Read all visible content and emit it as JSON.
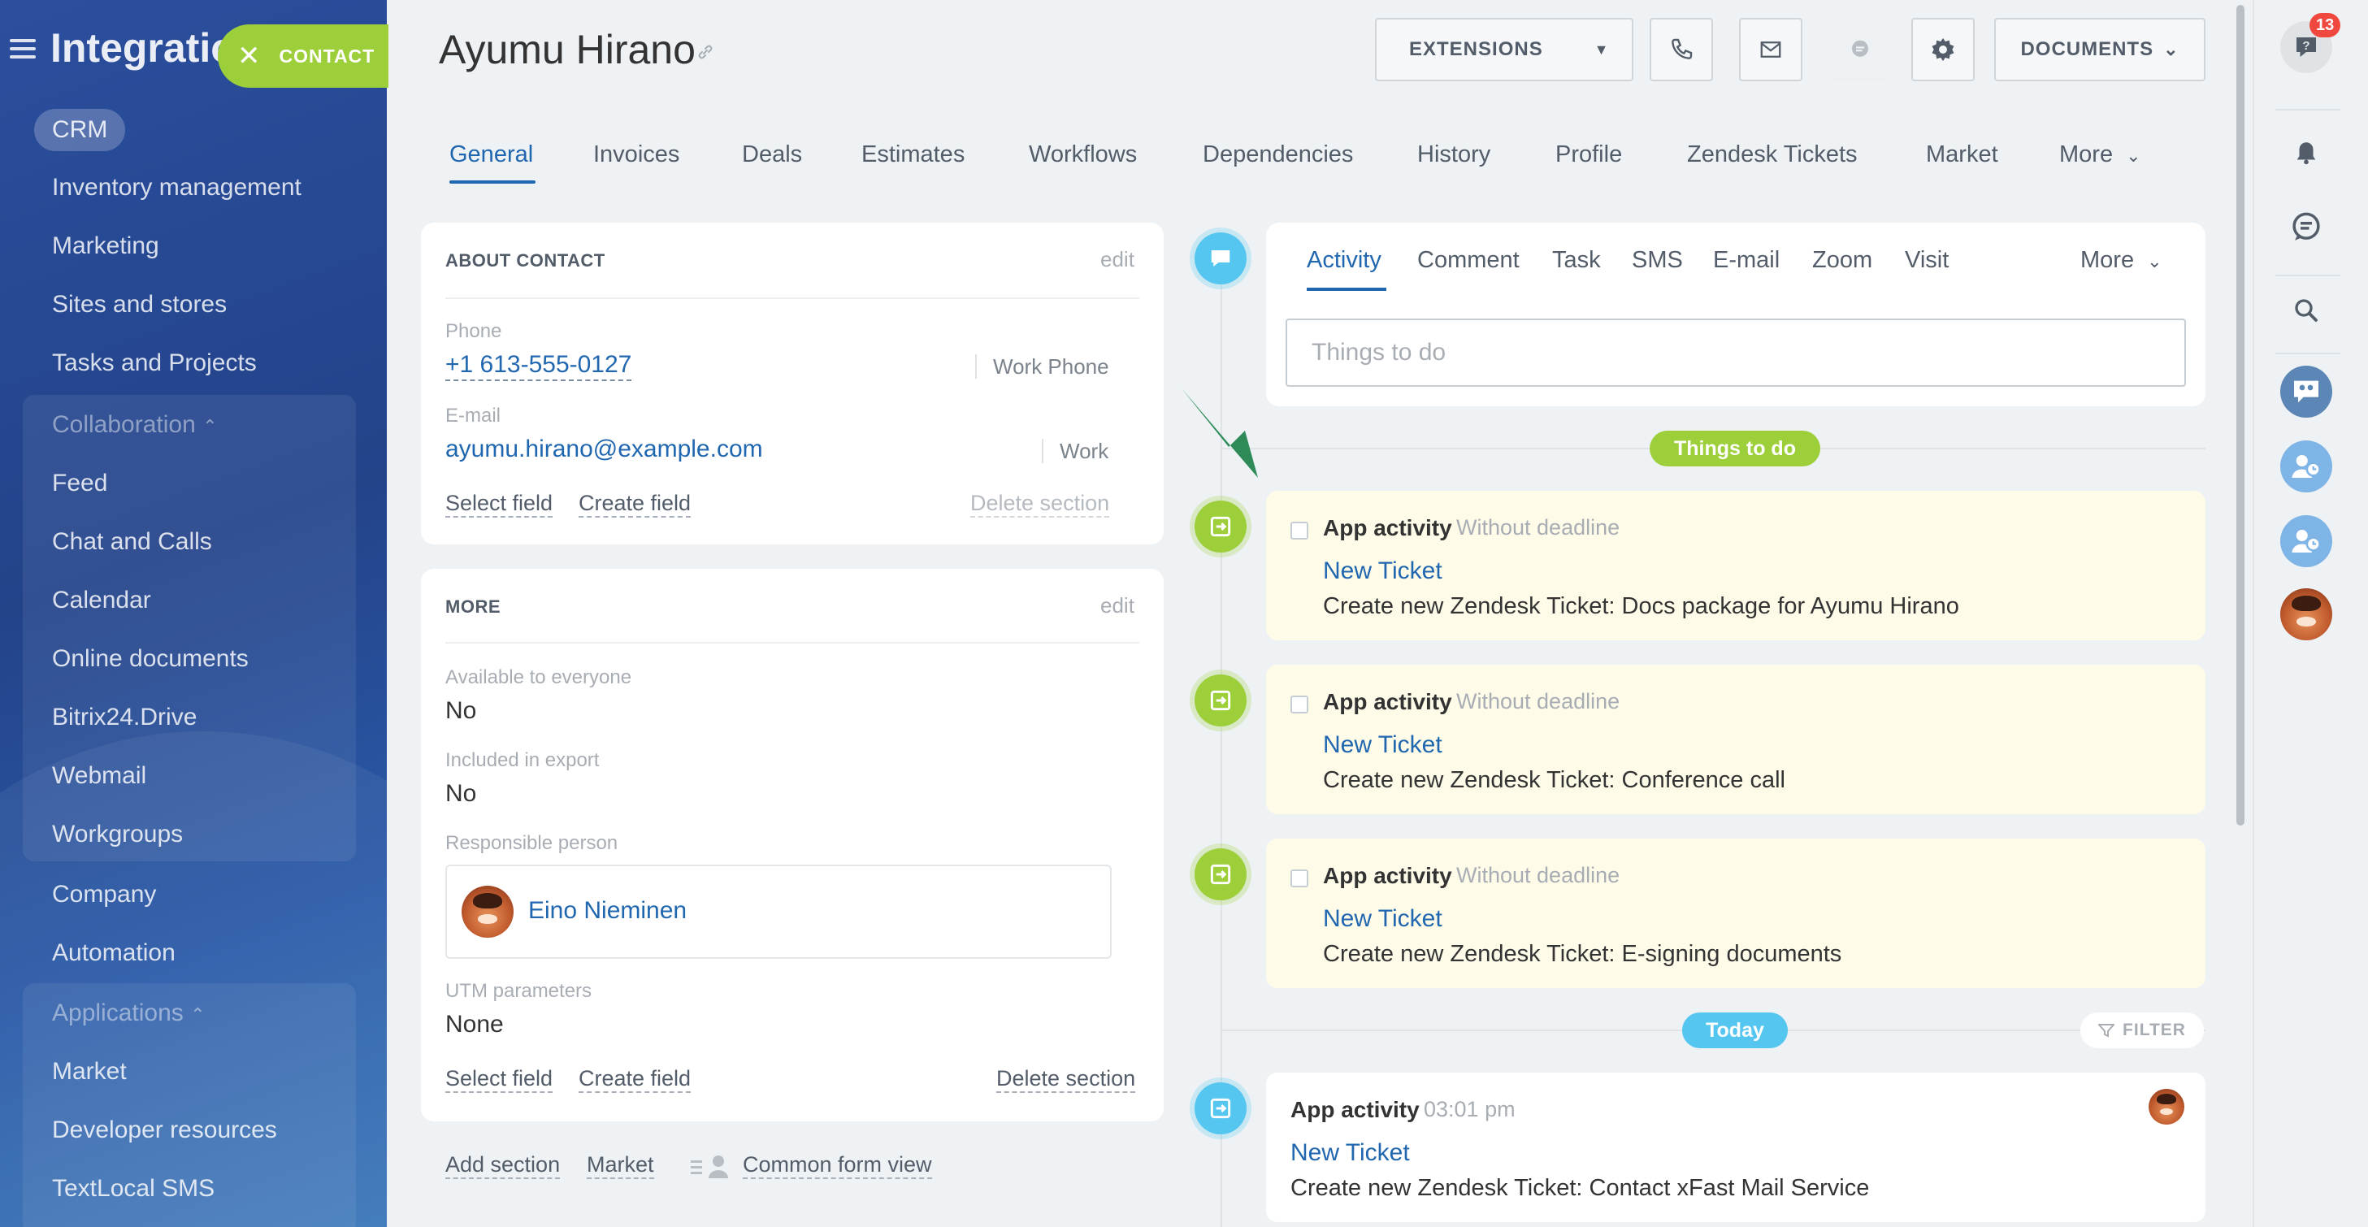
{
  "sidebar": {
    "title": "Integratio",
    "contact_button": "CONTACT",
    "crm": "CRM",
    "items_top": [
      "Inventory management",
      "Marketing",
      "Sites and stores",
      "Tasks and Projects"
    ],
    "collaboration_title": "Collaboration",
    "collaboration_items": [
      "Feed",
      "Chat and Calls",
      "Calendar",
      "Online documents",
      "Bitrix24.Drive",
      "Webmail",
      "Workgroups"
    ],
    "items_mid": [
      "Company",
      "Automation"
    ],
    "applications_title": "Applications",
    "applications_items": [
      "Market",
      "Developer resources",
      "TextLocal SMS"
    ]
  },
  "header": {
    "title": "Ayumu Hirano",
    "extensions": "EXTENSIONS",
    "documents": "DOCUMENTS"
  },
  "tabs": [
    "General",
    "Invoices",
    "Deals",
    "Estimates",
    "Workflows",
    "Dependencies",
    "History",
    "Profile",
    "Zendesk Tickets",
    "Market",
    "More"
  ],
  "about": {
    "heading": "ABOUT CONTACT",
    "edit": "edit",
    "phone_label": "Phone",
    "phone": "+1 613-555-0127",
    "phone_type": "Work Phone",
    "email_label": "E-mail",
    "email": "ayumu.hirano@example.com",
    "email_type": "Work",
    "select_field": "Select field",
    "create_field": "Create field",
    "delete_section": "Delete section"
  },
  "more": {
    "heading": "MORE",
    "edit": "edit",
    "available_label": "Available to everyone",
    "available_value": "No",
    "export_label": "Included in export",
    "export_value": "No",
    "responsible_label": "Responsible person",
    "responsible_name": "Eino Nieminen",
    "utm_label": "UTM parameters",
    "utm_value": "None",
    "select_field": "Select field",
    "create_field": "Create field",
    "delete_section": "Delete section"
  },
  "footer_links": {
    "add_section": "Add section",
    "market": "Market",
    "common_form_view": "Common form view"
  },
  "editor": {
    "tabs": [
      "Activity",
      "Comment",
      "Task",
      "SMS",
      "E-mail",
      "Zoom",
      "Visit"
    ],
    "more": "More",
    "placeholder": "Things to do"
  },
  "timeline": {
    "things_to_do": "Things to do",
    "today": "Today",
    "filter": "FILTER",
    "pending": [
      {
        "title": "App activity",
        "deadline": "Without deadline",
        "link": "New Ticket",
        "desc": "Create new Zendesk Ticket: Docs package for Ayumu Hirano"
      },
      {
        "title": "App activity",
        "deadline": "Without deadline",
        "link": "New Ticket",
        "desc": "Create new Zendesk Ticket: Conference call"
      },
      {
        "title": "App activity",
        "deadline": "Without deadline",
        "link": "New Ticket",
        "desc": "Create new Zendesk Ticket: E-signing documents"
      }
    ],
    "today_item": {
      "title": "App activity",
      "time": "03:01 pm",
      "link": "New Ticket",
      "desc": "Create new Zendesk Ticket: Contact xFast Mail Service"
    }
  },
  "rail": {
    "badge": "13"
  },
  "colors": {
    "sidebar": "#234389",
    "accent_green": "#9dcf3a",
    "accent_blue": "#55c6ef",
    "link": "#2067b0",
    "activity_bg": "#fefbe9"
  }
}
